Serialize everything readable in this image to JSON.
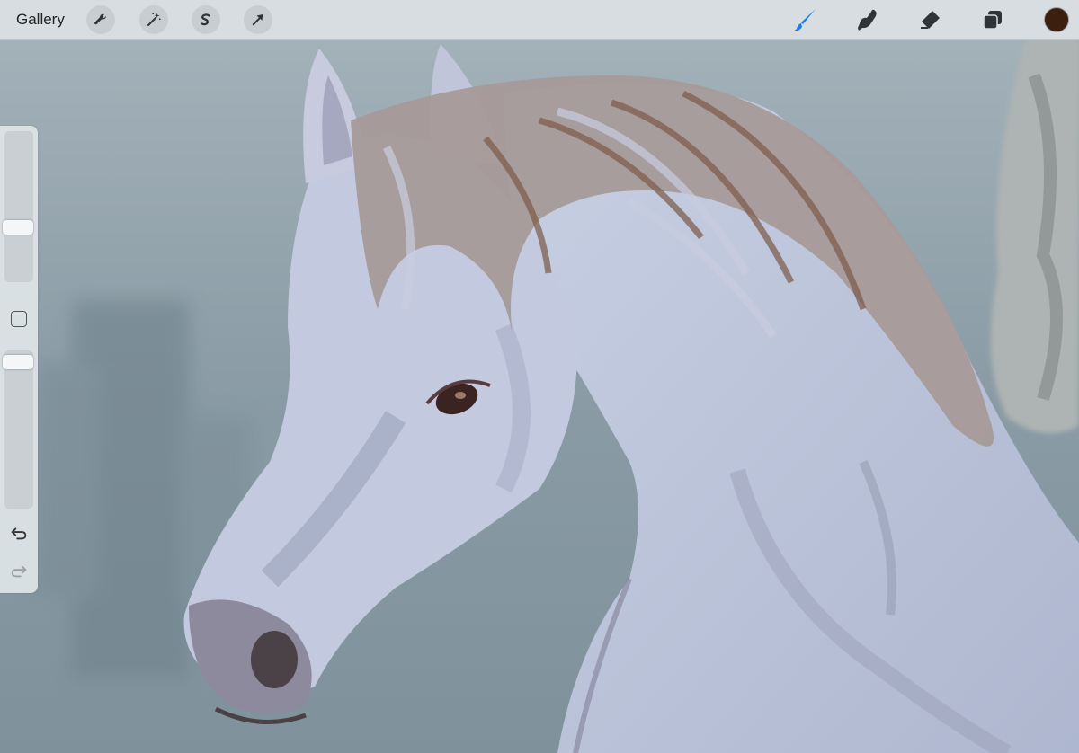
{
  "toolbar": {
    "gallery_label": "Gallery",
    "left_tools": [
      {
        "id": "actions",
        "icon": "wrench-icon"
      },
      {
        "id": "adjustments",
        "icon": "magic-wand-icon"
      },
      {
        "id": "selection",
        "icon": "selection-s-icon"
      },
      {
        "id": "transform",
        "icon": "arrow-cursor-icon"
      }
    ],
    "right_tools": [
      {
        "id": "brush",
        "icon": "brush-icon",
        "active": true
      },
      {
        "id": "smudge",
        "icon": "smudge-finger-icon",
        "active": false
      },
      {
        "id": "eraser",
        "icon": "eraser-icon",
        "active": false
      },
      {
        "id": "layers",
        "icon": "layers-icon",
        "active": false
      }
    ],
    "current_color": "#3d1f10",
    "accent_color": "#1a7bf2"
  },
  "sidebar": {
    "brush_size_level": 0.35,
    "opacity_level": 0.97,
    "modify_icon": "square-modify-icon",
    "undo_icon": "undo-icon",
    "redo_icon": "redo-icon"
  }
}
